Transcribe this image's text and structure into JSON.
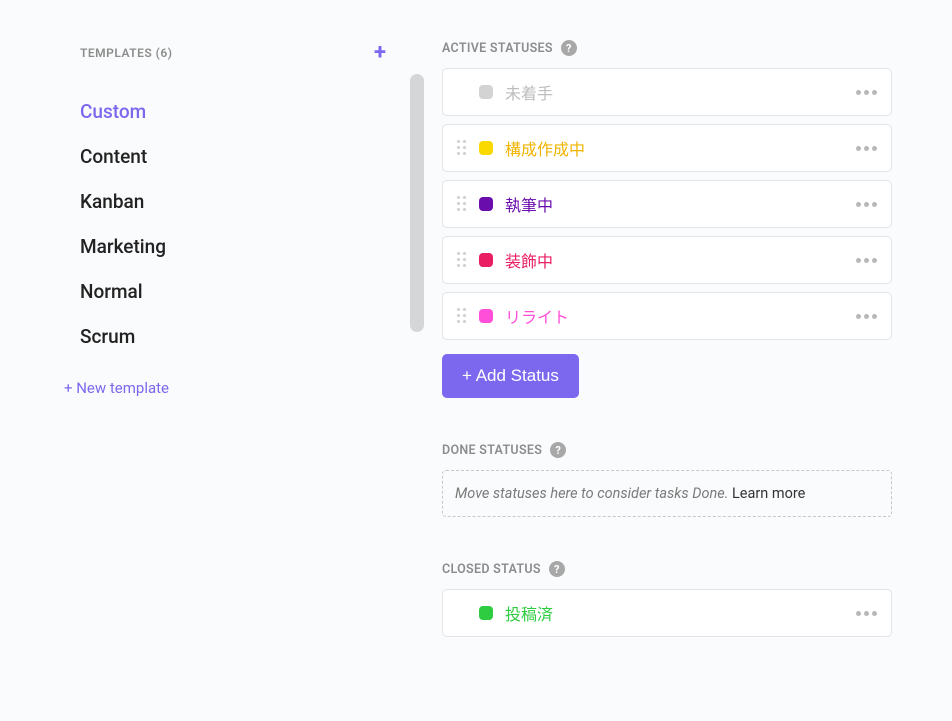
{
  "sidebar": {
    "title": "TEMPLATES (6)",
    "items": [
      {
        "label": "Custom",
        "active": true
      },
      {
        "label": "Content",
        "active": false
      },
      {
        "label": "Kanban",
        "active": false
      },
      {
        "label": "Marketing",
        "active": false
      },
      {
        "label": "Normal",
        "active": false
      },
      {
        "label": "Scrum",
        "active": false
      }
    ],
    "new_template_label": "+ New template"
  },
  "sections": {
    "active": {
      "title": "ACTIVE STATUSES",
      "statuses": [
        {
          "label": "未着手",
          "color": "#d3d3d3",
          "text_color": "#bdbdbd",
          "draggable": false
        },
        {
          "label": "構成作成中",
          "color": "#f9d900",
          "text_color": "#f0b400",
          "draggable": true
        },
        {
          "label": "執筆中",
          "color": "#6a0dad",
          "text_color": "#6a0dad",
          "draggable": true
        },
        {
          "label": "装飾中",
          "color": "#e91e63",
          "text_color": "#e91e63",
          "draggable": true
        },
        {
          "label": "リライト",
          "color": "#ff4fd8",
          "text_color": "#ff4fd8",
          "draggable": true
        }
      ],
      "add_button": "+ Add Status"
    },
    "done": {
      "title": "DONE STATUSES",
      "placeholder": "Move statuses here to consider tasks Done. ",
      "learn_more": "Learn more"
    },
    "closed": {
      "title": "CLOSED STATUS",
      "statuses": [
        {
          "label": "投稿済",
          "color": "#2ecc40",
          "text_color": "#2ecc40",
          "draggable": false
        }
      ]
    }
  }
}
